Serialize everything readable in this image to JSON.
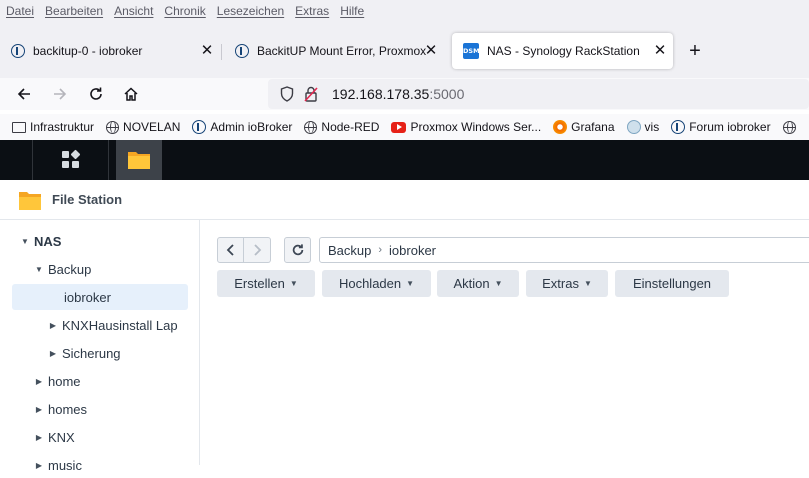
{
  "menu": [
    "Datei",
    "Bearbeiten",
    "Ansicht",
    "Chronik",
    "Lesezeichen",
    "Extras",
    "Hilfe"
  ],
  "tabs": [
    {
      "title": "backitup-0 - iobroker",
      "icon": "iobroker-icon",
      "active": false
    },
    {
      "title": "BackitUP Mount Error, Proxmox",
      "icon": "iobroker-icon",
      "active": false
    },
    {
      "title": "NAS - Synology RackStation",
      "icon": "dsm-icon",
      "active": true
    }
  ],
  "tab_close_glyph": "✕",
  "new_tab_glyph": "+",
  "dsm_favicon_text": "DSM",
  "url": {
    "host": "192.168.178.35",
    "port": ":5000"
  },
  "bookmarks": [
    {
      "label": "Infrastruktur",
      "icon": "folder-icon"
    },
    {
      "label": "NOVELAN",
      "icon": "globe-icon"
    },
    {
      "label": "Admin ioBroker",
      "icon": "iobroker-icon"
    },
    {
      "label": "Node-RED",
      "icon": "globe-icon"
    },
    {
      "label": "Proxmox Windows Ser...",
      "icon": "youtube-icon"
    },
    {
      "label": "Grafana",
      "icon": "grafana-icon"
    },
    {
      "label": "vis",
      "icon": "vis-icon"
    },
    {
      "label": "Forum iobroker",
      "icon": "iobroker-icon"
    }
  ],
  "app": {
    "title": "File Station"
  },
  "tree": {
    "root": "NAS",
    "items": [
      {
        "label": "Backup",
        "level": 1,
        "expanded": true
      },
      {
        "label": "iobroker",
        "level": 2,
        "selected": true
      },
      {
        "label": "KNXHausinstall Lap",
        "level": 2,
        "expanded": false
      },
      {
        "label": "Sicherung",
        "level": 2,
        "expanded": false
      },
      {
        "label": "home",
        "level": 1,
        "expanded": false
      },
      {
        "label": "homes",
        "level": 1,
        "expanded": false
      },
      {
        "label": "KNX",
        "level": 1,
        "expanded": false
      },
      {
        "label": "music",
        "level": 1,
        "expanded": false
      }
    ]
  },
  "path": [
    "Backup",
    "iobroker"
  ],
  "toolbar": {
    "create": "Erstellen",
    "upload": "Hochladen",
    "action": "Aktion",
    "extras": "Extras",
    "settings": "Einstellungen"
  },
  "colors": {
    "accent": "#1a74d6",
    "selected_row": "#e6f0fb",
    "taskbar": "#0b0f14"
  }
}
